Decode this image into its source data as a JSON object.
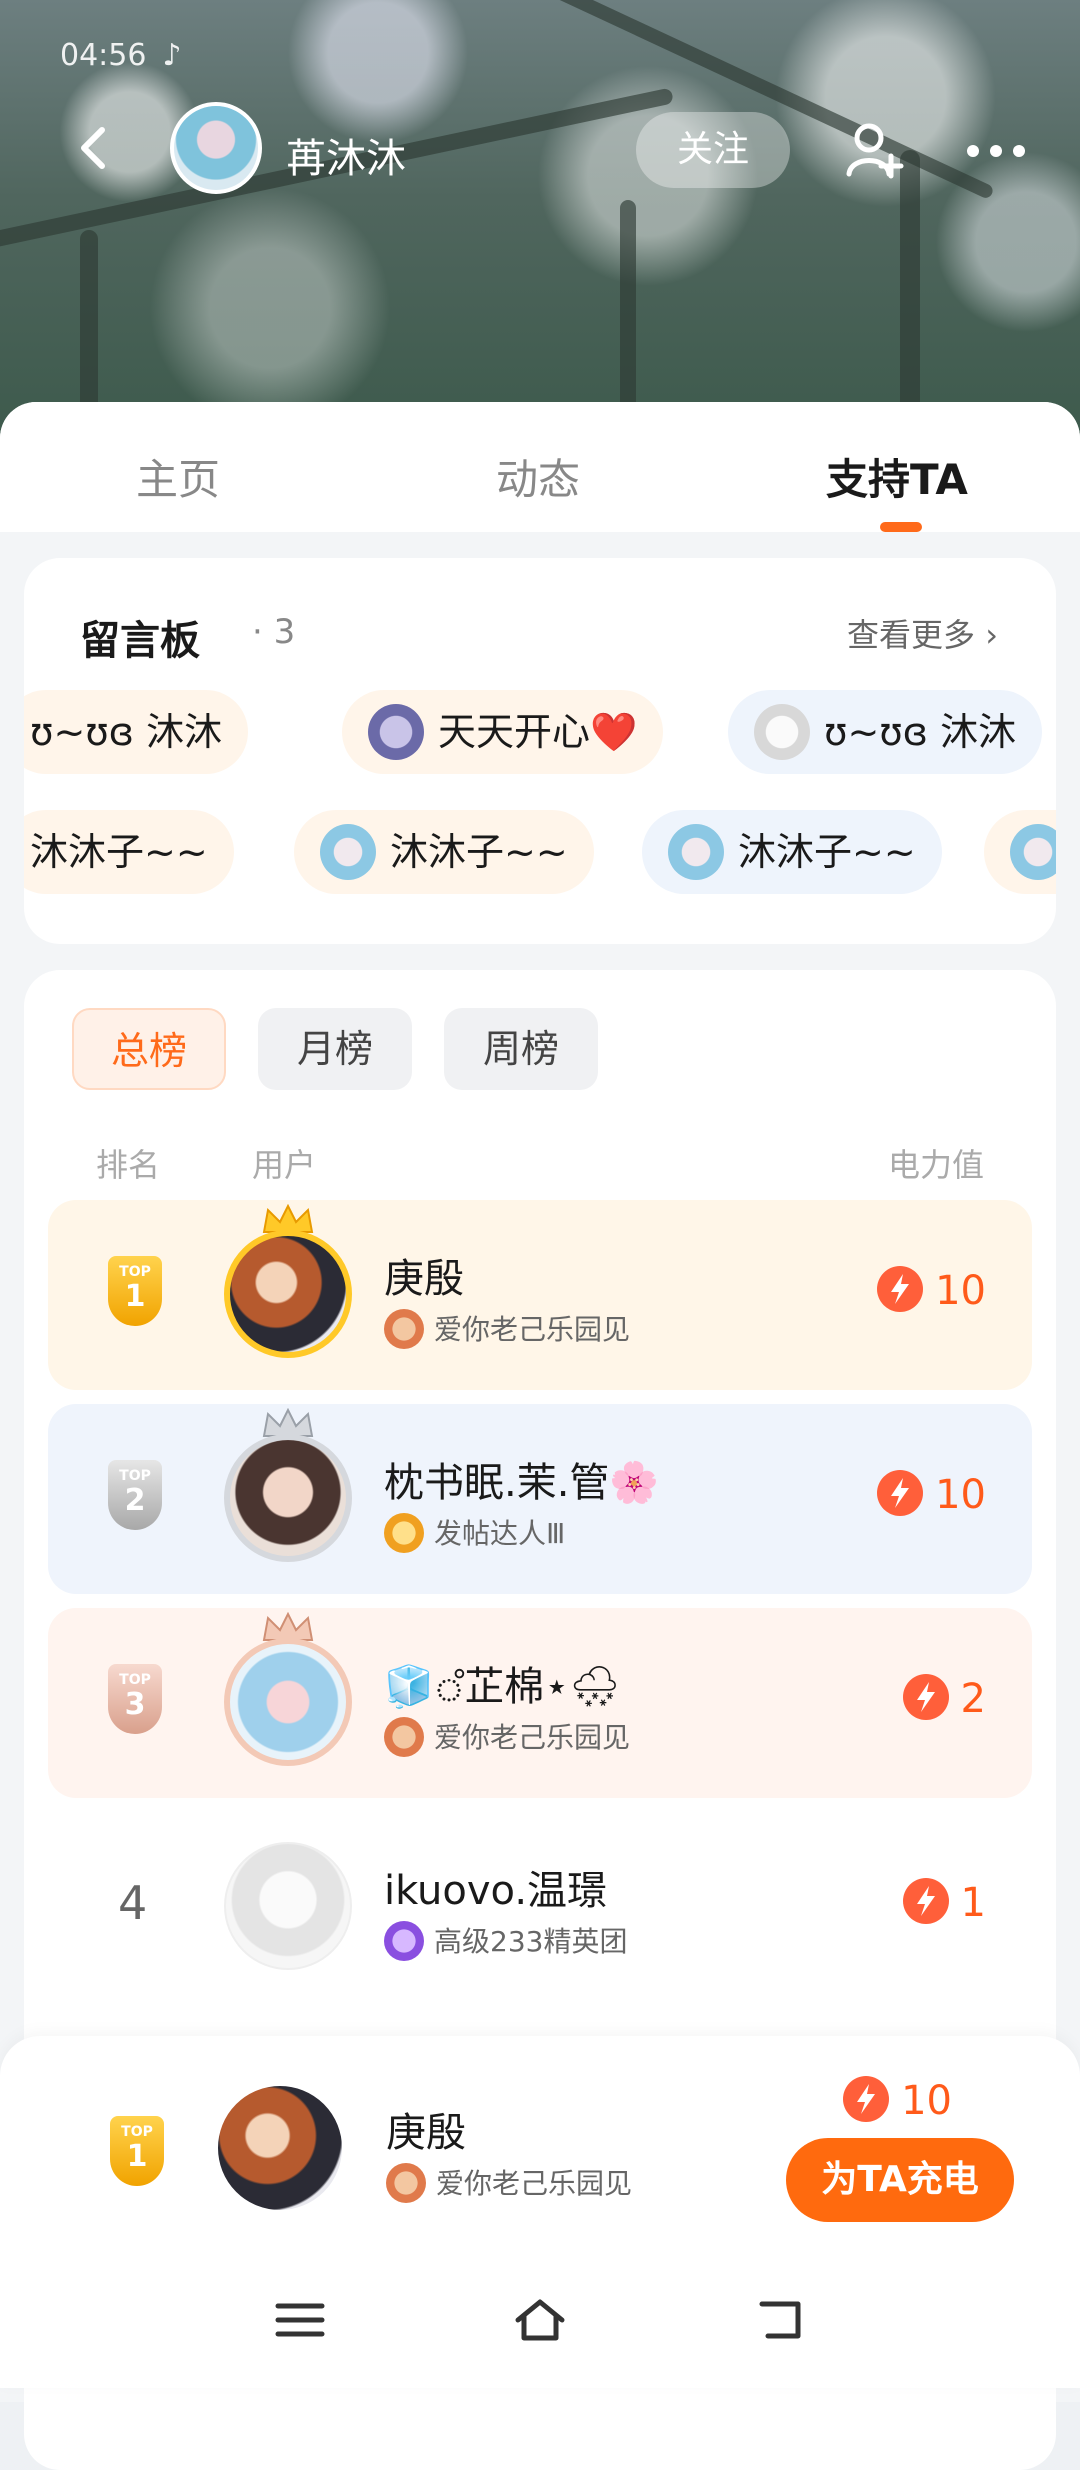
{
  "status_bar": {
    "time": "04:56",
    "app_glyph": "♪"
  },
  "header": {
    "username": "苒沐沐",
    "follow_label": "关注",
    "icons": [
      "back-icon",
      "add-user-icon",
      "more-icon"
    ]
  },
  "tabs": [
    {
      "label": "主页"
    },
    {
      "label": "动态"
    },
    {
      "label": "支持TA",
      "active": true
    }
  ],
  "message_board": {
    "title": "留言板",
    "count": "· 3",
    "more_label": "查看更多 ›",
    "chips_row1": [
      {
        "text": "ʊ~ʊɞ 沐沐"
      },
      {
        "text": "天天开心❤️"
      },
      {
        "text": "ʊ~ʊɞ 沐沐"
      }
    ],
    "chips_row2": [
      {
        "text": "沐沐子~~"
      },
      {
        "text": "沐沐子~~"
      },
      {
        "text": "沐沐子~~"
      }
    ]
  },
  "ranking": {
    "tabs": [
      {
        "label": "总榜",
        "active": true
      },
      {
        "label": "月榜"
      },
      {
        "label": "周榜"
      }
    ],
    "col_rank": "排名",
    "col_user": "用户",
    "col_power": "电力值",
    "rows": [
      {
        "rank": "1",
        "badge_top": "TOP",
        "name": "庚殷",
        "tag": "爱你老己乐园见",
        "power": "10"
      },
      {
        "rank": "2",
        "badge_top": "TOP",
        "name": "枕书眠.茉.管🌸",
        "tag": "发帖达人Ⅲ",
        "power": "10"
      },
      {
        "rank": "3",
        "badge_top": "TOP",
        "name": "🧊ஂ芷棉⋆🌨",
        "tag": "爱你老己乐园见",
        "power": "2"
      },
      {
        "rank": "4",
        "name": "ikuovo.温璟",
        "tag": "高级233精英团",
        "power": "1"
      }
    ]
  },
  "my_rank": {
    "badge_top": "TOP",
    "rank": "1",
    "name": "庚殷",
    "tag": "爱你老己乐园见",
    "power": "10",
    "charge_label": "为TA充电"
  },
  "colors": {
    "accent": "#ff6a1a",
    "gold": "#f1a300"
  }
}
